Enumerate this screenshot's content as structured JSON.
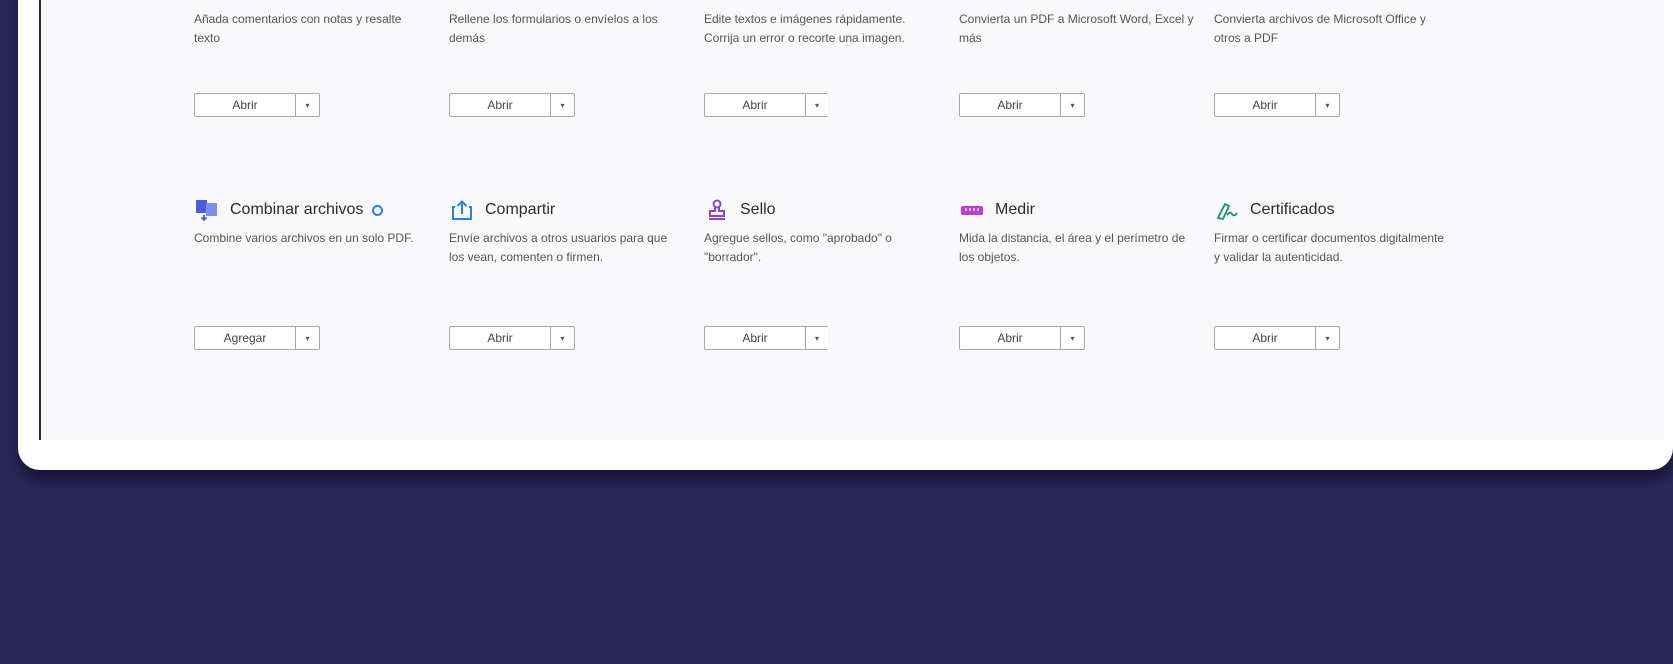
{
  "colors": {
    "background": "#2b2858",
    "card": "#ffffff",
    "panel": "#f9f9fb",
    "accent_blue": "#2680eb"
  },
  "row1": [
    {
      "description": "Añada comentarios con notas y resalte texto",
      "button": "Abrir"
    },
    {
      "description": "Rellene los formularios o envíelos a los demás",
      "button": "Abrir"
    },
    {
      "description": "Edite textos e imágenes rápidamente. Corrija un error o recorte una imagen.",
      "button": "Abrir"
    },
    {
      "description": "Convierta un PDF a Microsoft Word, Excel y más",
      "button": "Abrir"
    },
    {
      "description": "Convierta archivos de Microsoft Office y otros a PDF",
      "button": "Abrir"
    }
  ],
  "row2": [
    {
      "title": "Combinar archivos",
      "icon": "combine-files-icon",
      "description": "Combine varios archivos en un solo PDF.",
      "button": "Agregar"
    },
    {
      "title": "Compartir",
      "icon": "share-icon",
      "description": "Envíe archivos a otros usuarios para que los vean, comenten o firmen.",
      "button": "Abrir"
    },
    {
      "title": "Sello",
      "icon": "stamp-icon",
      "description": "Agregue sellos, como \"aprobado\" o \"borrador\".",
      "button": "Abrir"
    },
    {
      "title": "Medir",
      "icon": "ruler-icon",
      "description": "Mida la distancia, el área y el perímetro de los objetos.",
      "button": "Abrir"
    },
    {
      "title": "Certificados",
      "icon": "certificate-pen-icon",
      "description": "Firmar o certificar documentos digitalmente y validar la autenticidad.",
      "button": "Abrir"
    }
  ],
  "caret_glyph": "▾"
}
